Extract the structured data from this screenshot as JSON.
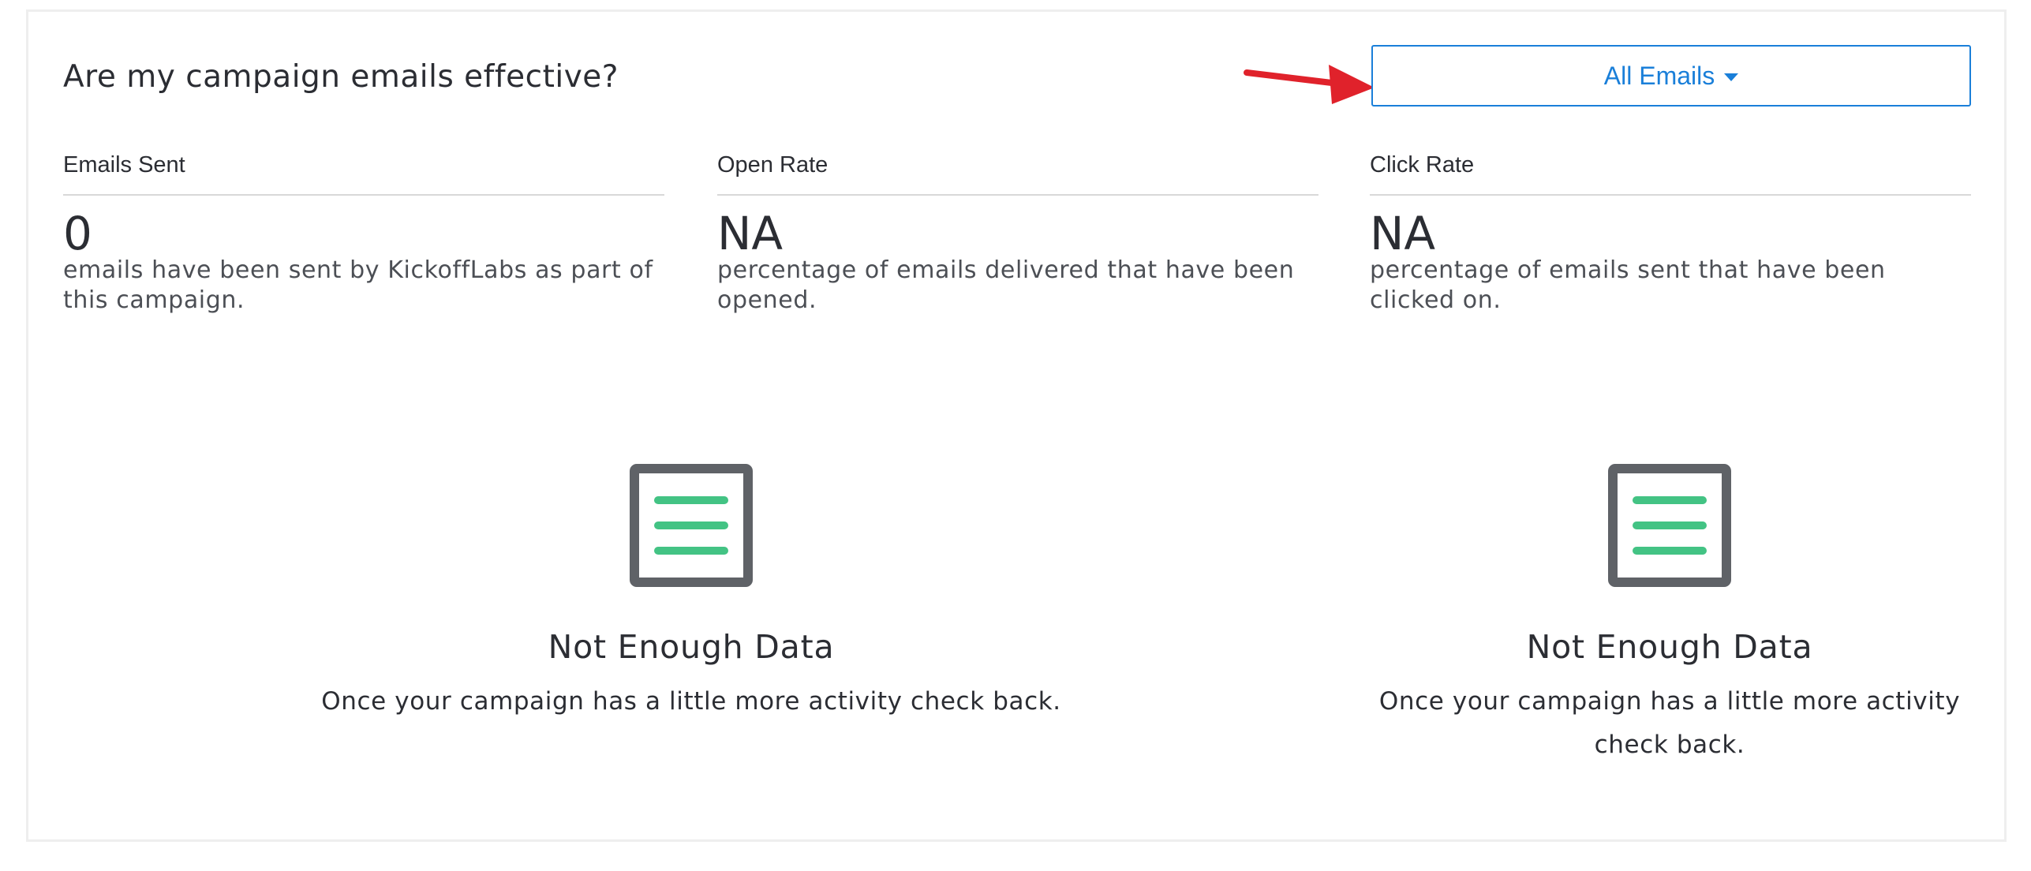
{
  "header": {
    "title": "Are my campaign emails effective?"
  },
  "filter": {
    "label": "All Emails",
    "caret_icon": "caret-down-icon"
  },
  "annotation": {
    "icon": "red-arrow-icon",
    "color": "#e0222b"
  },
  "stats": [
    {
      "label": "Emails Sent",
      "value": "0",
      "description": "emails have been sent by KickoffLabs as part of this campaign."
    },
    {
      "label": "Open Rate",
      "value": "NA",
      "description": "percentage of emails delivered that have been opened."
    },
    {
      "label": "Click Rate",
      "value": "NA",
      "description": "percentage of emails sent that have been clicked on."
    }
  ],
  "empty_states": [
    {
      "icon": "document-list-icon",
      "title": "Not Enough Data",
      "description": "Once your campaign has a little more activity check back."
    },
    {
      "icon": "document-list-icon",
      "title": "Not Enough Data",
      "description": "Once your campaign has a little more activity check back."
    }
  ],
  "colors": {
    "accent": "#1a7fd9",
    "icon_frame": "#5f6267",
    "icon_lines": "#43c384",
    "divider": "#d8d8d8"
  }
}
